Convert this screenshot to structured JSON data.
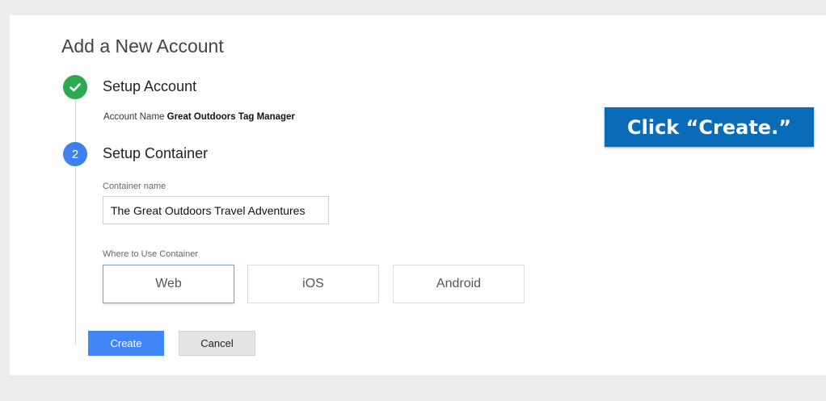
{
  "page": {
    "title": "Add a New Account"
  },
  "step1": {
    "icon": "check-icon",
    "label": "Setup Account",
    "account_prefix": "Account Name",
    "account_name": "Great Outdoors Tag Manager"
  },
  "step2": {
    "number": "2",
    "label": "Setup Container",
    "container_name_label": "Container name",
    "container_name_value": "The Great Outdoors Travel Adventures",
    "where_label": "Where to Use Container",
    "options": [
      {
        "label": "Web",
        "selected": true
      },
      {
        "label": "iOS",
        "selected": false
      },
      {
        "label": "Android",
        "selected": false
      }
    ]
  },
  "actions": {
    "create_label": "Create",
    "cancel_label": "Cancel"
  },
  "callout": {
    "text": "Click “Create.”"
  },
  "colors": {
    "success": "#2fa94f",
    "accent": "#4285f4",
    "callout": "#0a6cb8"
  }
}
